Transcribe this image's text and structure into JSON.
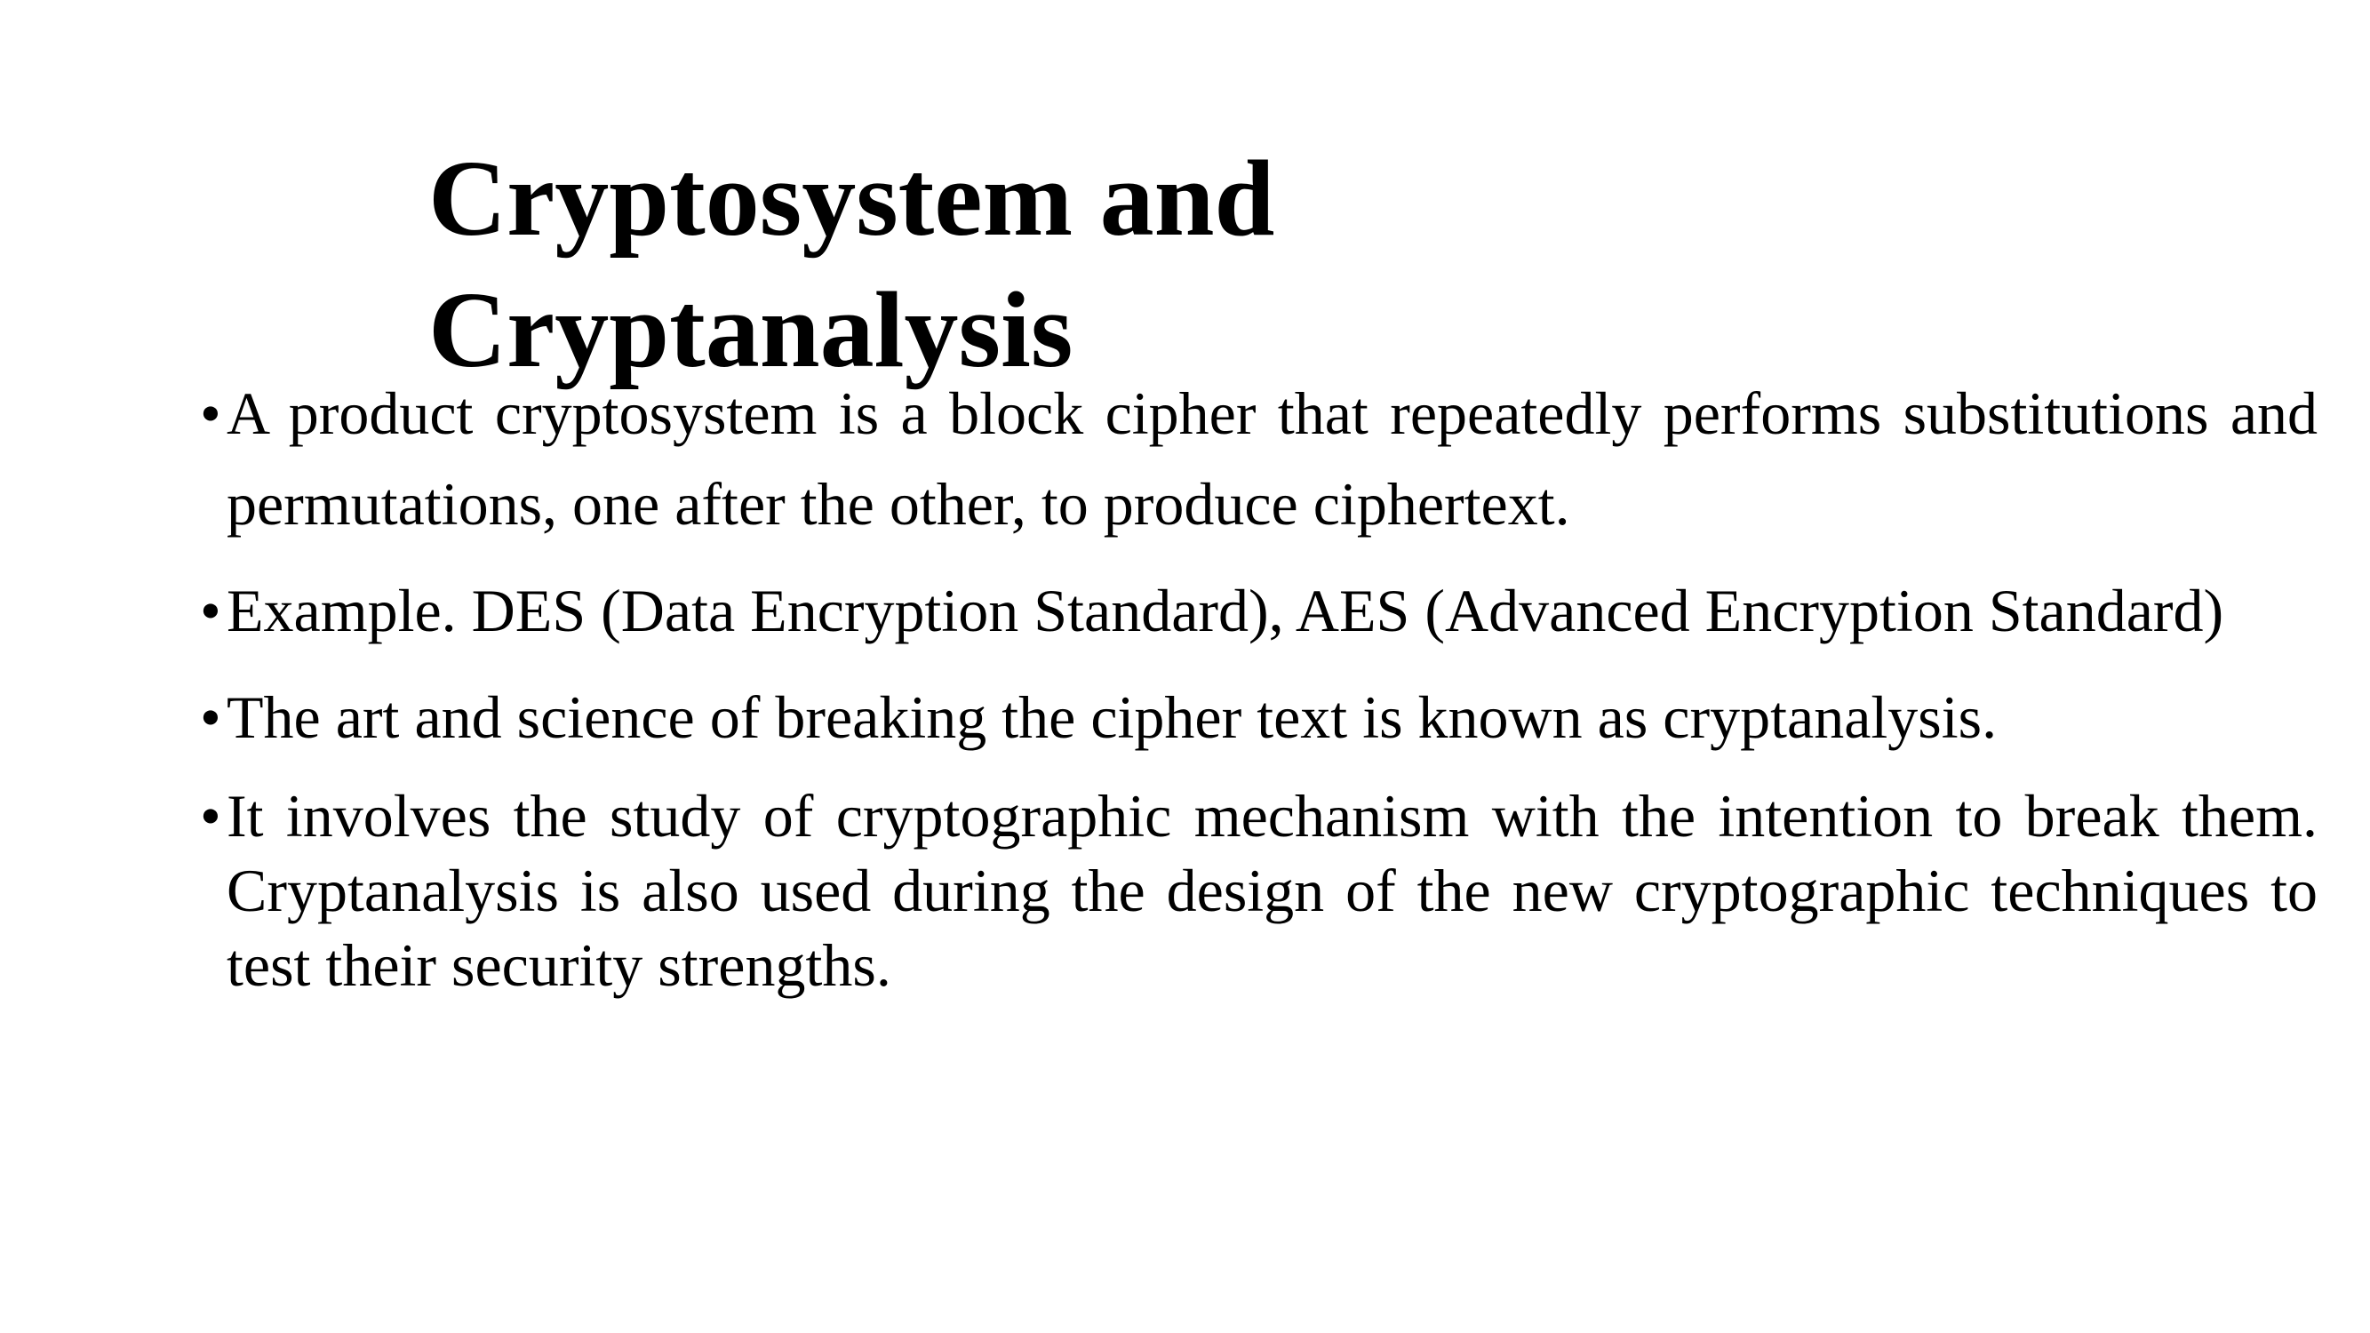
{
  "slide": {
    "title_lines": [
      "Cryptosystem and",
      "Cryptanalysis"
    ],
    "bullets": [
      "A product cryptosystem is a block cipher that repeatedly performs substitutions and permutations, one after the other, to produce ciphertext.",
      "Example. DES (Data Encryption Standard), AES (Advanced Encryption Standard)",
      "The art and science of breaking the cipher text is known as cryptanalysis.",
      "It involves the study of cryptographic mechanism with the intention to break them. Cryptanalysis is also used during the design of the new cryptographic techniques to test their security strengths."
    ]
  }
}
